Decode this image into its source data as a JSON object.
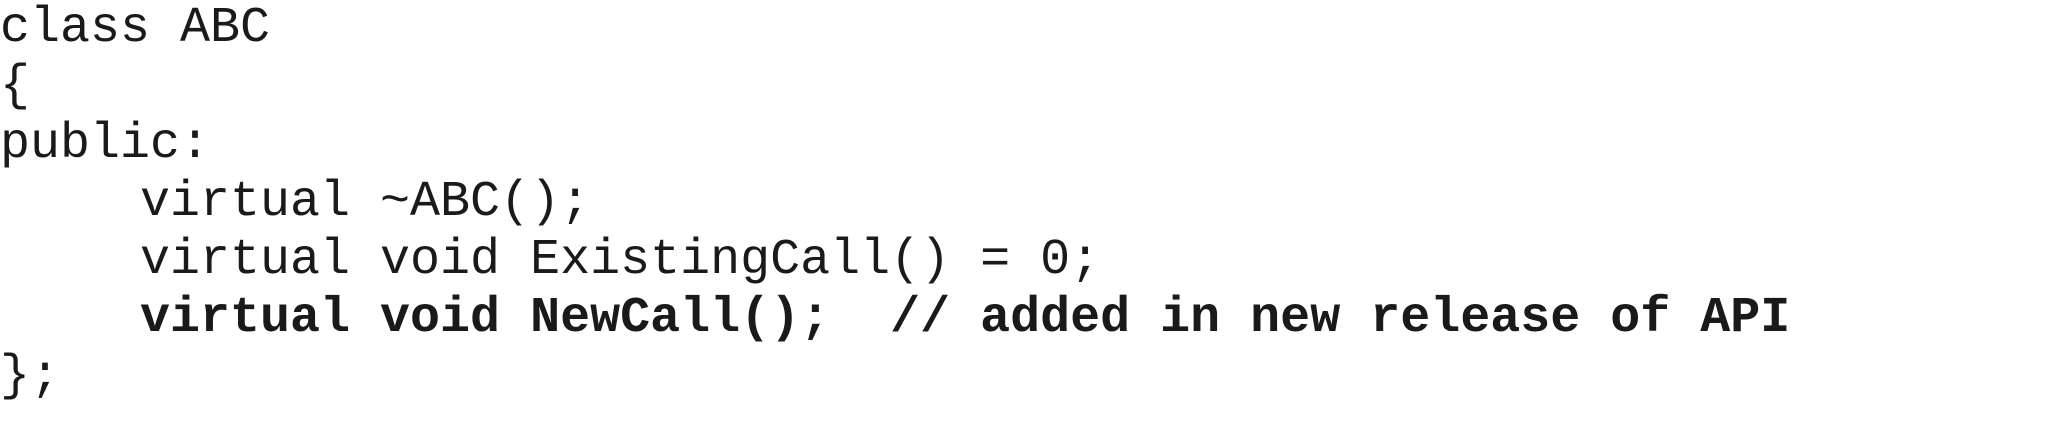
{
  "code": {
    "lines": [
      {
        "text": "class ABC",
        "indent": false,
        "bold": false
      },
      {
        "text": "{",
        "indent": false,
        "bold": false
      },
      {
        "text": "public:",
        "indent": false,
        "bold": false
      },
      {
        "text": "virtual ~ABC();",
        "indent": true,
        "bold": false
      },
      {
        "text": "virtual void ExistingCall() = 0;",
        "indent": true,
        "bold": false
      },
      {
        "text": "virtual void NewCall();  // added in new release of API",
        "indent": true,
        "bold": true
      },
      {
        "text": "};",
        "indent": false,
        "bold": false
      }
    ]
  }
}
